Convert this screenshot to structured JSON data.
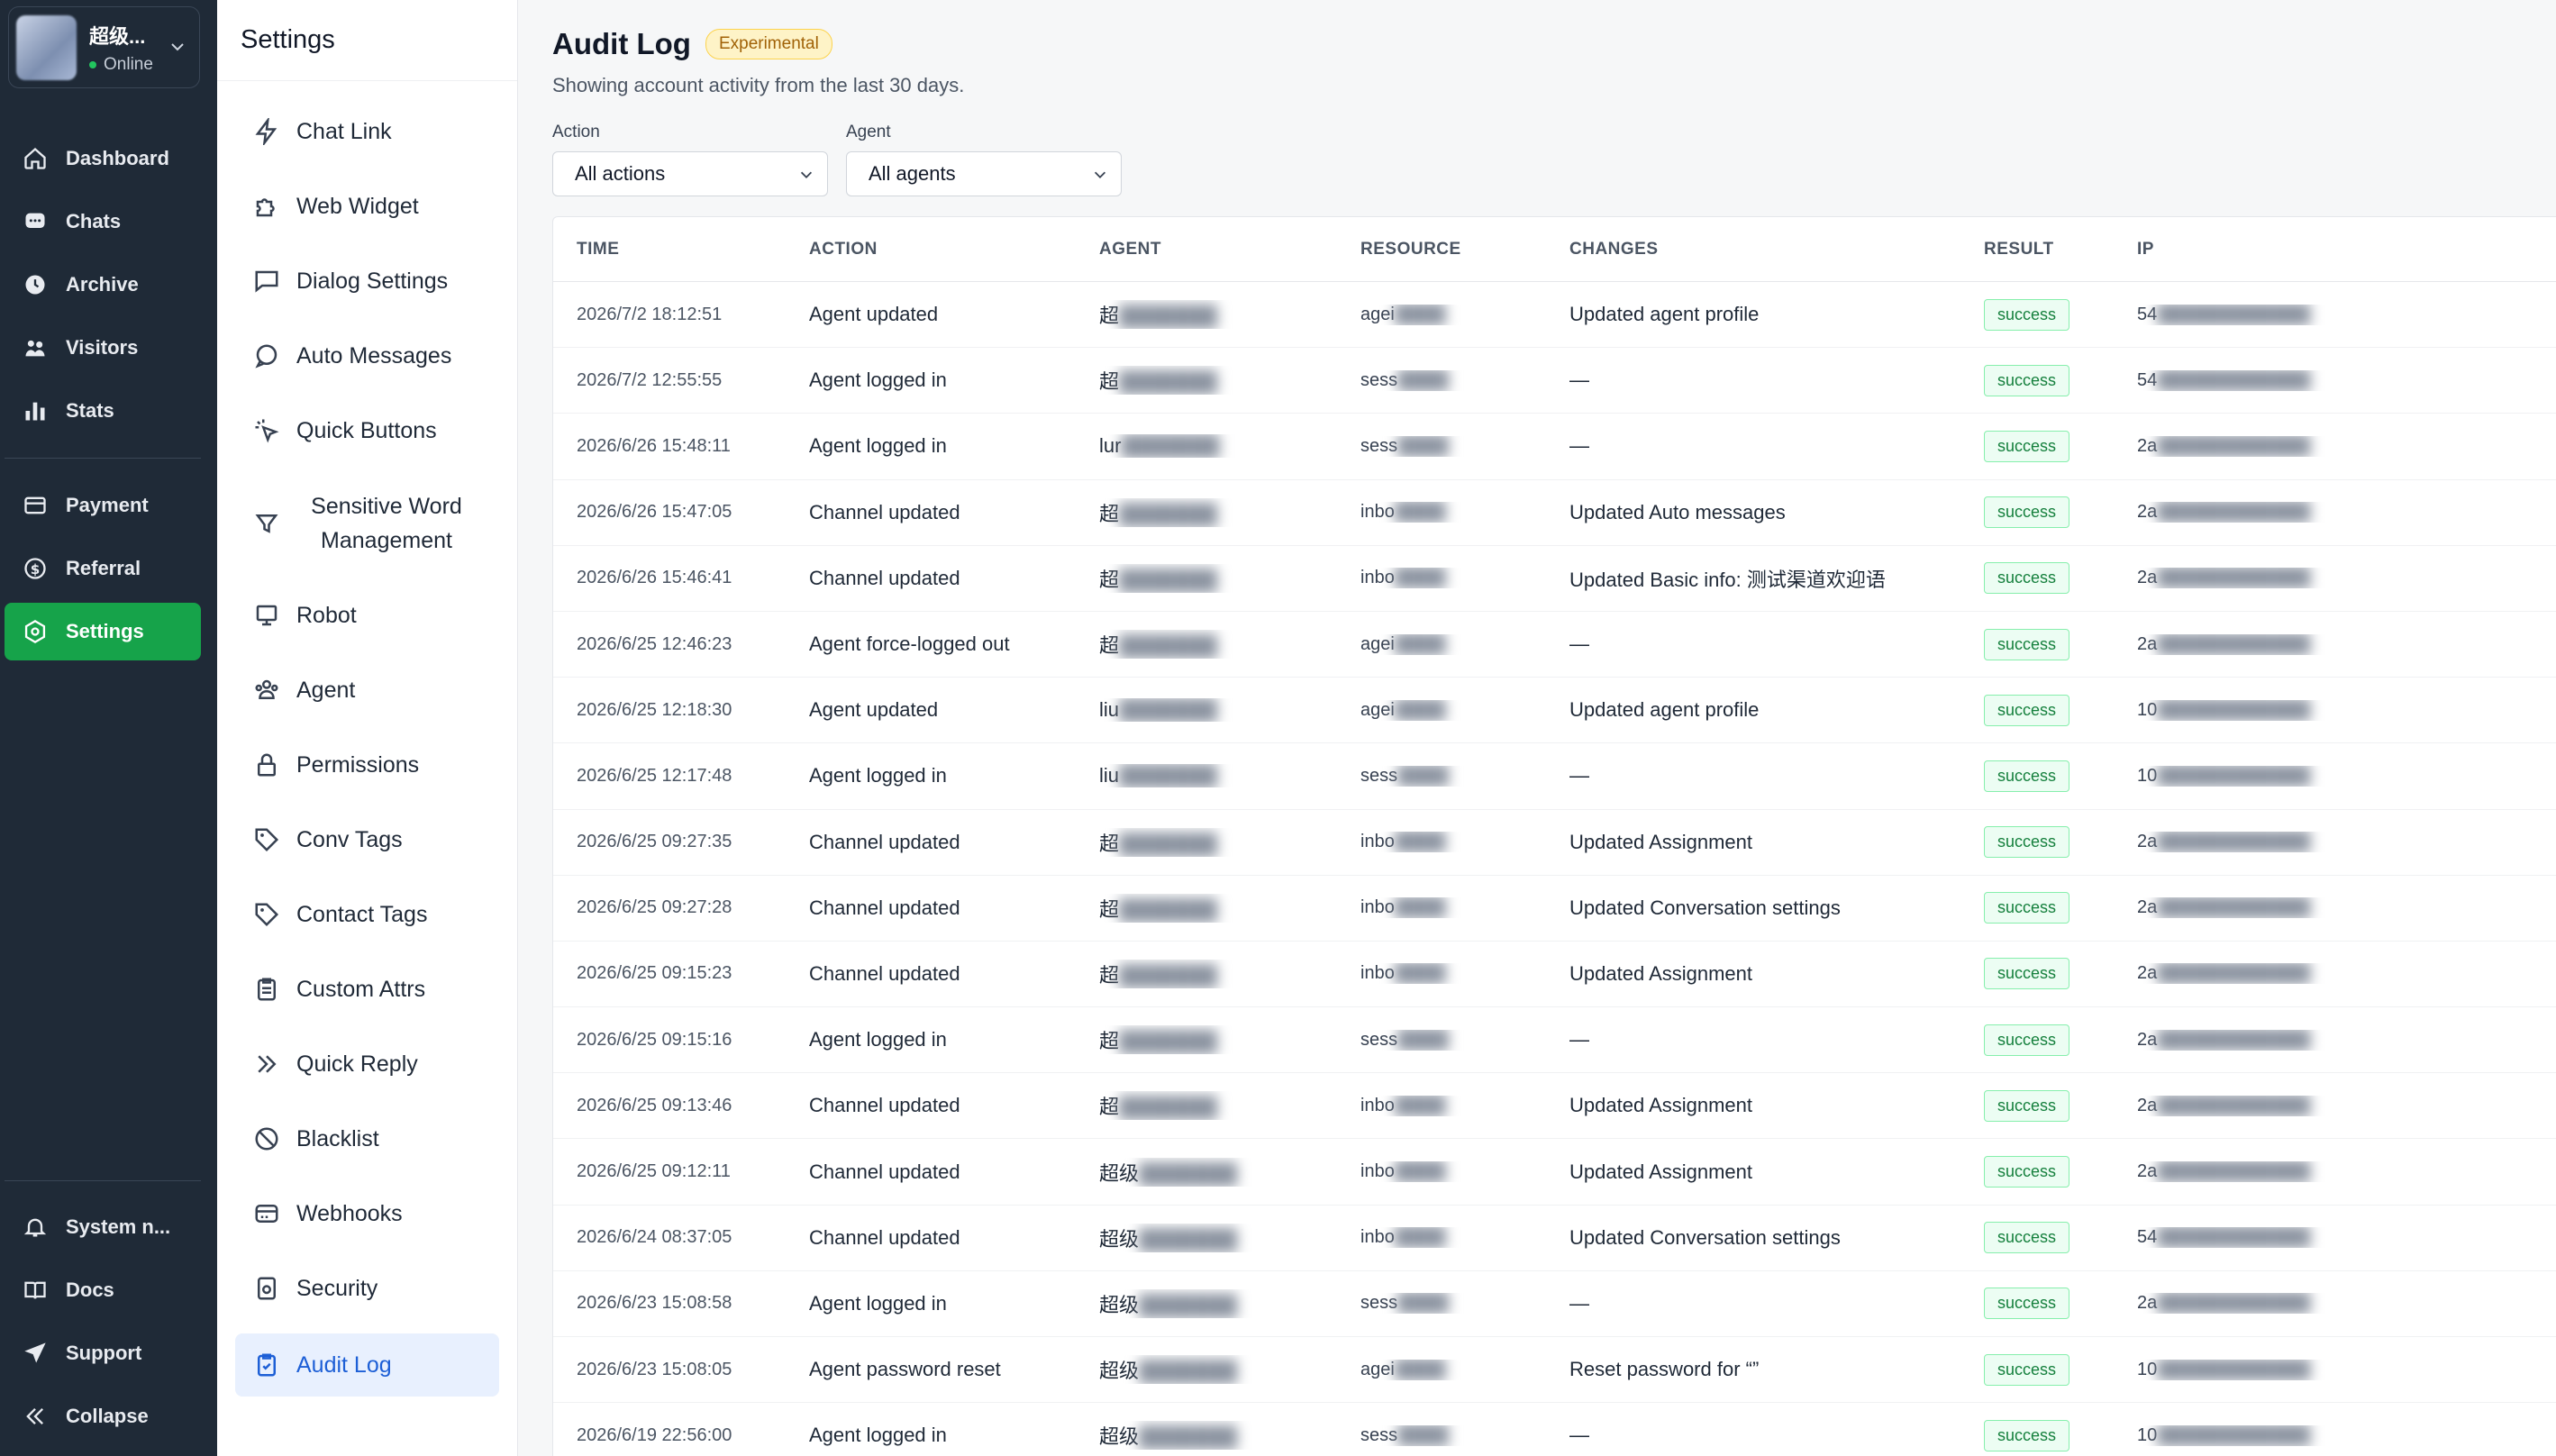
{
  "account": {
    "name": "超级...",
    "status": "Online"
  },
  "nav": {
    "items": [
      {
        "label": "Dashboard",
        "icon": "home-icon"
      },
      {
        "label": "Chats",
        "icon": "chat-icon"
      },
      {
        "label": "Archive",
        "icon": "archive-icon"
      },
      {
        "label": "Visitors",
        "icon": "visitors-icon"
      },
      {
        "label": "Stats",
        "icon": "stats-icon"
      }
    ],
    "items2": [
      {
        "label": "Payment",
        "icon": "payment-icon"
      },
      {
        "label": "Referral",
        "icon": "referral-icon"
      },
      {
        "label": "Settings",
        "icon": "settings-icon",
        "active": true
      }
    ],
    "bottom": [
      {
        "label": "System n...",
        "icon": "bell-icon"
      },
      {
        "label": "Docs",
        "icon": "book-icon"
      },
      {
        "label": "Support",
        "icon": "send-icon"
      },
      {
        "label": "Collapse",
        "icon": "collapse-icon"
      }
    ]
  },
  "settings": {
    "title": "Settings",
    "items": [
      {
        "label": "Chat Link",
        "icon": "bolt-icon"
      },
      {
        "label": "Web Widget",
        "icon": "puzzle-icon"
      },
      {
        "label": "Dialog Settings",
        "icon": "dialog-icon"
      },
      {
        "label": "Auto Messages",
        "icon": "message-icon"
      },
      {
        "label": "Quick Buttons",
        "icon": "click-icon"
      },
      {
        "label": "Sensitive Word Management",
        "icon": "filter-icon"
      },
      {
        "label": "Robot",
        "icon": "robot-icon"
      },
      {
        "label": "Agent",
        "icon": "agent-icon"
      },
      {
        "label": "Permissions",
        "icon": "lock-icon"
      },
      {
        "label": "Conv Tags",
        "icon": "tag-icon"
      },
      {
        "label": "Contact Tags",
        "icon": "tag-icon"
      },
      {
        "label": "Custom Attrs",
        "icon": "clipboard-icon"
      },
      {
        "label": "Quick Reply",
        "icon": "chevrons-icon"
      },
      {
        "label": "Blacklist",
        "icon": "ban-icon"
      },
      {
        "label": "Webhooks",
        "icon": "webhook-icon"
      },
      {
        "label": "Security",
        "icon": "security-icon"
      },
      {
        "label": "Audit Log",
        "icon": "audit-icon",
        "active": true
      }
    ]
  },
  "page": {
    "title": "Audit Log",
    "badge": "Experimental",
    "subtitle": "Showing account activity from the last 30 days."
  },
  "filters": {
    "action_label": "Action",
    "action_value": "All actions",
    "agent_label": "Agent",
    "agent_value": "All agents"
  },
  "table": {
    "headers": [
      "TIME",
      "ACTION",
      "AGENT",
      "RESOURCE",
      "CHANGES",
      "RESULT",
      "IP"
    ],
    "rows": [
      {
        "time": "2026/7/2 18:12:51",
        "action": "Agent updated",
        "agent": "超",
        "res": "agei",
        "changes": "Updated agent profile",
        "result": "success",
        "ip": "54"
      },
      {
        "time": "2026/7/2 12:55:55",
        "action": "Agent logged in",
        "agent": "超",
        "res": "sess",
        "changes": "—",
        "result": "success",
        "ip": "54"
      },
      {
        "time": "2026/6/26 15:48:11",
        "action": "Agent logged in",
        "agent": "lur",
        "res": "sess",
        "changes": "—",
        "result": "success",
        "ip": "2a"
      },
      {
        "time": "2026/6/26 15:47:05",
        "action": "Channel updated",
        "agent": "超",
        "res": "inbo",
        "changes": "Updated Auto messages",
        "result": "success",
        "ip": "2a"
      },
      {
        "time": "2026/6/26 15:46:41",
        "action": "Channel updated",
        "agent": "超",
        "res": "inbo",
        "changes": "Updated Basic info: 测试渠道欢迎语",
        "result": "success",
        "ip": "2a"
      },
      {
        "time": "2026/6/25 12:46:23",
        "action": "Agent force-logged out",
        "agent": "超",
        "res": "agei",
        "changes": "—",
        "result": "success",
        "ip": "2a"
      },
      {
        "time": "2026/6/25 12:18:30",
        "action": "Agent updated",
        "agent": "liu",
        "res": "agei",
        "changes": "Updated agent profile",
        "result": "success",
        "ip": "10"
      },
      {
        "time": "2026/6/25 12:17:48",
        "action": "Agent logged in",
        "agent": "liu",
        "res": "sess",
        "changes": "—",
        "result": "success",
        "ip": "10"
      },
      {
        "time": "2026/6/25 09:27:35",
        "action": "Channel updated",
        "agent": "超",
        "res": "inbo",
        "changes": "Updated Assignment",
        "result": "success",
        "ip": "2a"
      },
      {
        "time": "2026/6/25 09:27:28",
        "action": "Channel updated",
        "agent": "超",
        "res": "inbo",
        "changes": "Updated Conversation settings",
        "result": "success",
        "ip": "2a"
      },
      {
        "time": "2026/6/25 09:15:23",
        "action": "Channel updated",
        "agent": "超",
        "res": "inbo",
        "changes": "Updated Assignment",
        "result": "success",
        "ip": "2a"
      },
      {
        "time": "2026/6/25 09:15:16",
        "action": "Agent logged in",
        "agent": "超",
        "res": "sess",
        "changes": "—",
        "result": "success",
        "ip": "2a"
      },
      {
        "time": "2026/6/25 09:13:46",
        "action": "Channel updated",
        "agent": "超",
        "res": "inbo",
        "changes": "Updated Assignment",
        "result": "success",
        "ip": "2a"
      },
      {
        "time": "2026/6/25 09:12:11",
        "action": "Channel updated",
        "agent": "超级",
        "res": "inbo",
        "changes": "Updated Assignment",
        "result": "success",
        "ip": "2a"
      },
      {
        "time": "2026/6/24 08:37:05",
        "action": "Channel updated",
        "agent": "超级",
        "res": "inbo",
        "changes": "Updated Conversation settings",
        "result": "success",
        "ip": "54"
      },
      {
        "time": "2026/6/23 15:08:58",
        "action": "Agent logged in",
        "agent": "超级",
        "res": "sess",
        "changes": "—",
        "result": "success",
        "ip": "2a"
      },
      {
        "time": "2026/6/23 15:08:05",
        "action": "Agent password reset",
        "agent": "超级",
        "res": "agei",
        "changes": "Reset password for “”",
        "result": "success",
        "ip": "10"
      },
      {
        "time": "2026/6/19 22:56:00",
        "action": "Agent logged in",
        "agent": "超级",
        "res": "sess",
        "changes": "—",
        "result": "success",
        "ip": "10"
      }
    ]
  },
  "colors": {
    "nav_bg": "#1f2a37",
    "accent": "#16a34a",
    "active_sub_bg": "#e8f0fe",
    "active_sub_text": "#1d5fd6"
  }
}
